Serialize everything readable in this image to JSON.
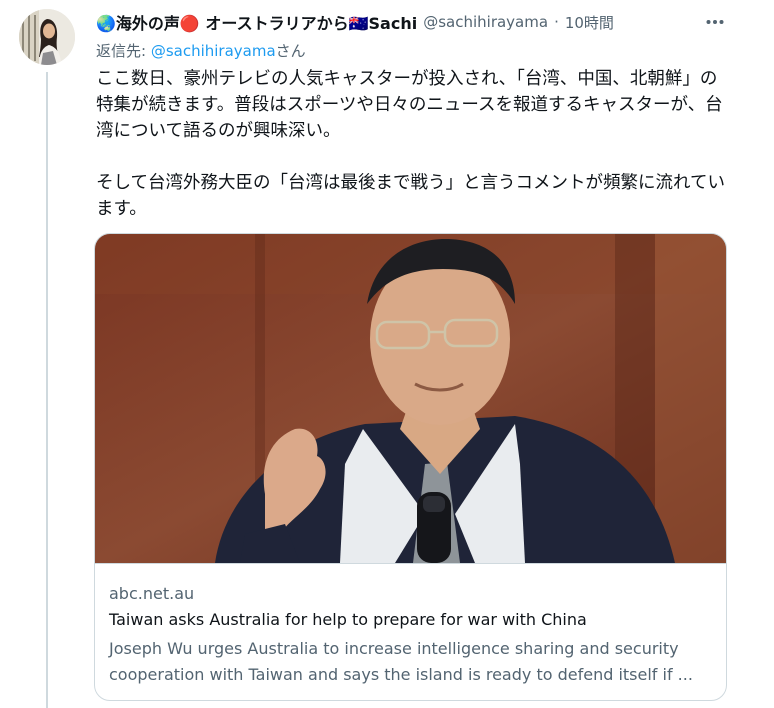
{
  "tweet": {
    "author": {
      "display_name": "🌏海外の声🔴 オーストラリアから🇦🇺Sachi",
      "handle": "@sachihirayama",
      "time": "10時間"
    },
    "reply_to": {
      "prefix": "返信先: ",
      "handle": "@sachihirayama",
      "suffix": "さん"
    },
    "text": {
      "paragraph_1": "ここ数日、豪州テレビの人気キャスターが投入され、「台湾、中国、北朝鮮」の特集が続きます。普段はスポーツや日々のニュースを報道するキャスターが、台湾について語るのが興味深い。",
      "paragraph_2": "そして台湾外務大臣の「台湾は最後まで戦う」と言うコメントが頻繁に流れています。"
    },
    "card": {
      "domain": "abc.net.au",
      "title": "Taiwan asks Australia for help to prepare for war with China",
      "description": "Joseph Wu urges Australia to increase intelligence sharing and security cooperation with Taiwan and says the island is ready to defend itself if ..."
    }
  },
  "icons": {
    "more": "more-dots-icon",
    "avatar": "avatar"
  },
  "colors": {
    "link": "#1d9bf0",
    "secondary_text": "#536471",
    "border": "#cfd9de"
  }
}
